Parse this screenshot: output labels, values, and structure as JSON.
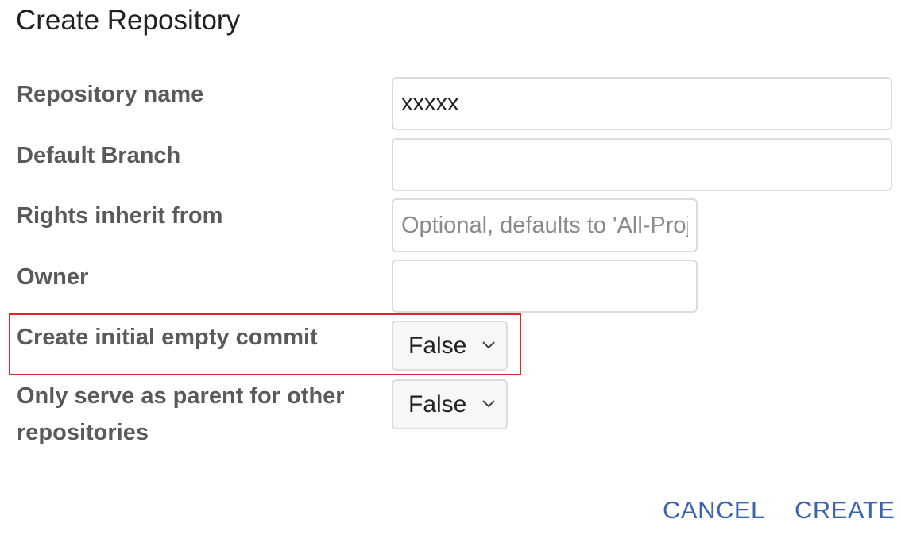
{
  "dialog": {
    "title": "Create Repository"
  },
  "form": {
    "repository_name": {
      "label": "Repository name",
      "value": "xxxxx",
      "placeholder": ""
    },
    "default_branch": {
      "label": "Default Branch",
      "value": "",
      "placeholder": ""
    },
    "rights_inherit_from": {
      "label": "Rights inherit from",
      "value": "",
      "placeholder": "Optional, defaults to 'All-Projects'"
    },
    "owner": {
      "label": "Owner",
      "value": "",
      "placeholder": ""
    },
    "create_initial_empty_commit": {
      "label": "Create initial empty commit",
      "selected": "False",
      "highlighted": true
    },
    "only_parent": {
      "label_line1": "Only serve as parent for other",
      "label_line2": "repositories",
      "selected": "False"
    }
  },
  "actions": {
    "cancel_label": "CANCEL",
    "create_label": "CREATE"
  },
  "colors": {
    "accent": "#3b63b0",
    "highlight": "#e0242a",
    "label_text": "#5a5a5a",
    "border": "#dcdcdc"
  },
  "icons": {
    "select_chevron": "chevron-down-icon"
  }
}
